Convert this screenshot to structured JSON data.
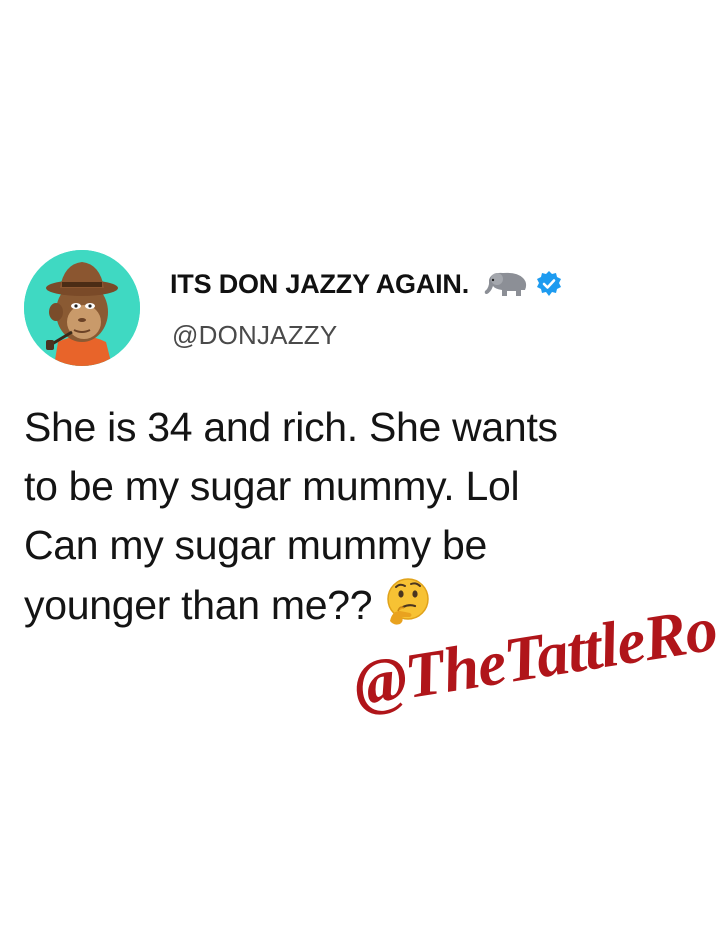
{
  "tweet": {
    "display_name": "ITS DON JAZZY AGAIN.",
    "handle": "@DONJAZZY",
    "verified": true,
    "name_emoji": "elephant-icon",
    "text_lines": [
      "She is 34 and rich. She wants",
      "to be my sugar mummy. Lol",
      "Can my sugar mummy be",
      "younger than me??"
    ],
    "text_emoji": "thinking-face-icon"
  },
  "watermark": {
    "text": "@TheTattleRo"
  },
  "colors": {
    "avatar_bg": "#3fd9c2",
    "verified_blue": "#1d9bf0",
    "watermark_red": "#b0151a",
    "text": "#141414",
    "handle": "#4a4a4a"
  }
}
